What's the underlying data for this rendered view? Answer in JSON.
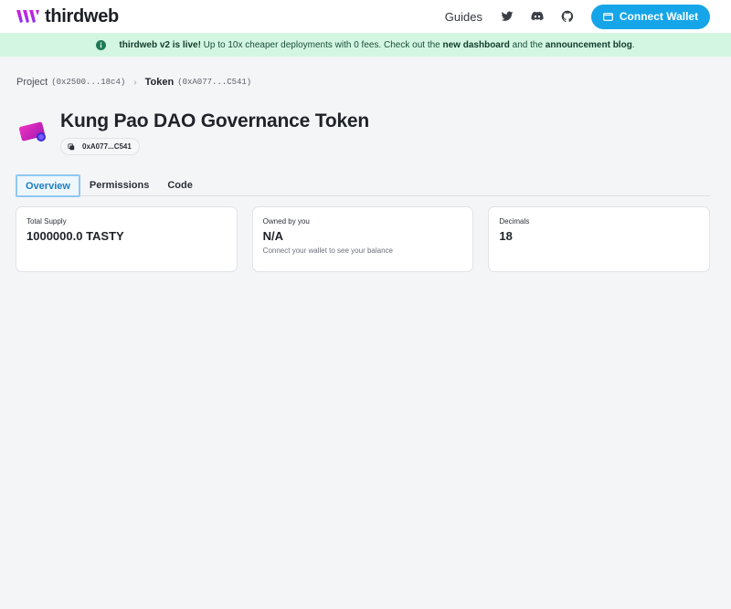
{
  "topbar": {
    "brand": "thirdweb",
    "guides": "Guides",
    "icons": [
      "twitter-icon",
      "discord-icon",
      "github-icon"
    ],
    "connect_label": "Connect Wallet"
  },
  "banner": {
    "lead": "thirdweb v2 is live!",
    "text1": " Up to 10x cheaper deployments with 0 fees. Check out the ",
    "link1": "new dashboard",
    "text2": " and the ",
    "link2": "announcement blog",
    "text3": "."
  },
  "breadcrumb": {
    "project_label": "Project",
    "project_addr": "(0x2500...18c4)",
    "token_label": "Token",
    "token_addr": "(0xA077...C541)"
  },
  "header": {
    "title": "Kung Pao DAO Governance Token",
    "address": "0xA077...C541"
  },
  "tabs": [
    {
      "label": "Overview",
      "active": true
    },
    {
      "label": "Permissions",
      "active": false
    },
    {
      "label": "Code",
      "active": false
    }
  ],
  "cards": [
    {
      "label": "Total Supply",
      "value": "1000000.0 TASTY",
      "sub": ""
    },
    {
      "label": "Owned by you",
      "value": "N/A",
      "sub": "Connect your wallet to see your balance"
    },
    {
      "label": "Decimals",
      "value": "18",
      "sub": ""
    }
  ],
  "colors": {
    "accent": "#16a5e8",
    "banner_bg": "#d3f6e2",
    "brand_gradient": [
      "#c026d3",
      "#7c3aed"
    ]
  }
}
